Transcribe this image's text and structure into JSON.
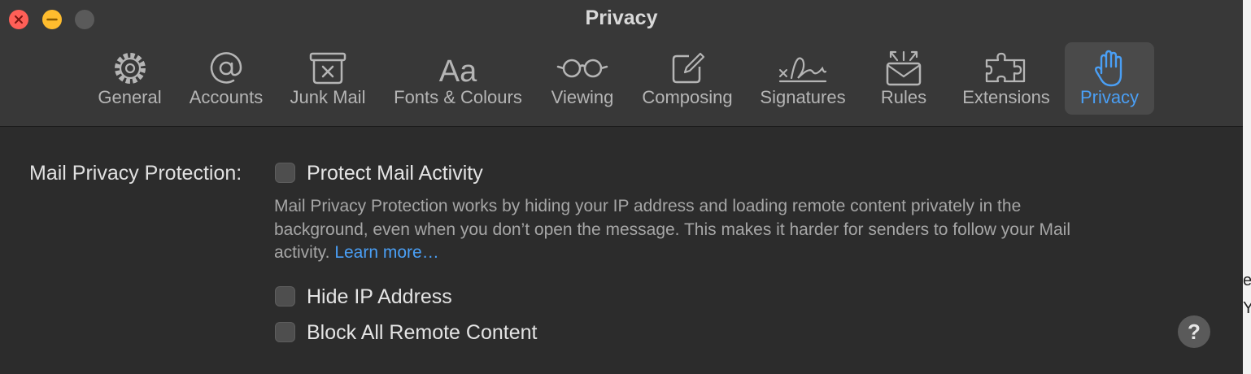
{
  "window": {
    "title": "Privacy",
    "traffic_lights": {
      "close": "#ff5f57",
      "minimize": "#febc2e",
      "zoom": "#5a5a5a"
    }
  },
  "toolbar": {
    "tabs": [
      {
        "label": "General",
        "icon": "gear-icon"
      },
      {
        "label": "Accounts",
        "icon": "at-sign-icon"
      },
      {
        "label": "Junk Mail",
        "icon": "junk-tray-icon"
      },
      {
        "label": "Fonts & Colours",
        "icon": "font-aa-icon"
      },
      {
        "label": "Viewing",
        "icon": "glasses-icon"
      },
      {
        "label": "Composing",
        "icon": "compose-pencil-icon"
      },
      {
        "label": "Signatures",
        "icon": "signature-icon"
      },
      {
        "label": "Rules",
        "icon": "envelope-arrows-icon"
      },
      {
        "label": "Extensions",
        "icon": "puzzle-piece-icon"
      },
      {
        "label": "Privacy",
        "icon": "raised-hand-icon",
        "selected": true
      }
    ]
  },
  "privacy": {
    "section_label": "Mail Privacy Protection:",
    "protect_mail_activity": {
      "label": "Protect Mail Activity",
      "checked": false
    },
    "description_line1": "Mail Privacy Protection works by hiding your IP address and loading remote content privately in the",
    "description_line2": "background, even when you don’t open the message. This makes it harder for senders to follow your Mail",
    "description_line3": "activity.",
    "learn_more": "Learn more…",
    "hide_ip_address": {
      "label": "Hide IP Address",
      "checked": false
    },
    "block_remote_content": {
      "label": "Block All Remote Content",
      "checked": false
    }
  },
  "help": {
    "label": "?"
  },
  "background_window_glyphs": [
    "e",
    "Y"
  ],
  "colors": {
    "accent": "#4a9ff5",
    "window_background": "#2c2c2c",
    "toolbar_background": "#383838",
    "selected_tab": "#4a4a4a"
  }
}
